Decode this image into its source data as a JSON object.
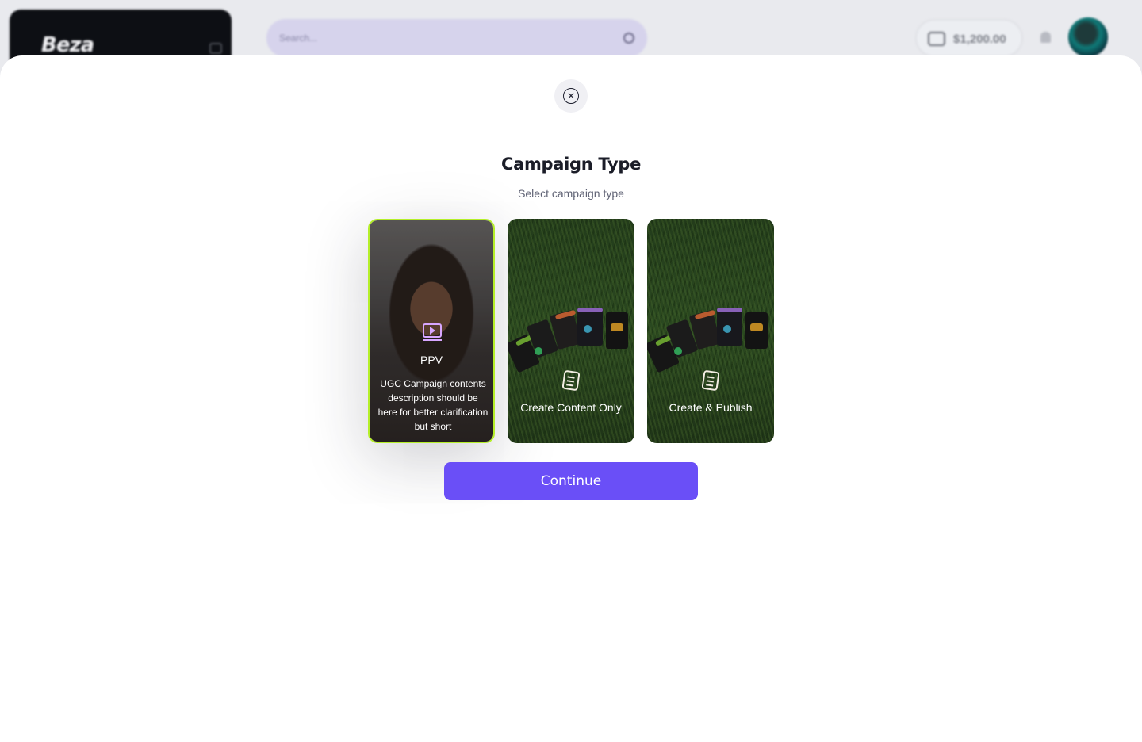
{
  "background": {
    "brand": "Beza",
    "search_placeholder": "Search...",
    "balance": "$1,200.00"
  },
  "modal": {
    "title": "Campaign Type",
    "subtitle": "Select campaign type",
    "close_icon": "close-circle-icon",
    "continue_label": "Continue"
  },
  "cards": [
    {
      "label": "PPV",
      "description": "UGC Campaign contents description should be here for better clarification but short",
      "icon": "video-play-icon",
      "selected": true
    },
    {
      "label": "Create Content Only",
      "icon": "document-icon",
      "selected": false
    },
    {
      "label": "Create & Publish",
      "icon": "document-icon",
      "selected": false
    }
  ],
  "colors": {
    "accent": "#6a4ff7",
    "selected_border": "#b5ef2a"
  }
}
